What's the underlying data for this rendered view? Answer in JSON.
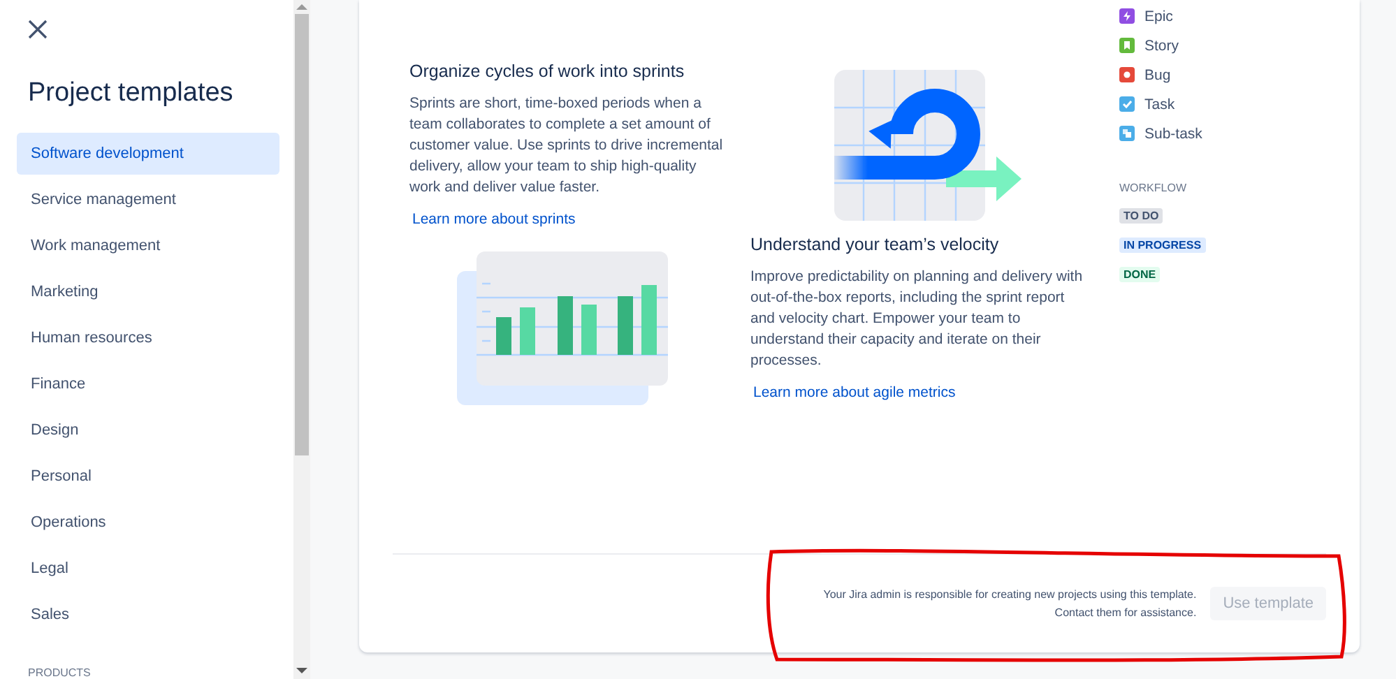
{
  "sidebar": {
    "title": "Project templates",
    "items": [
      {
        "label": "Software development",
        "selected": true
      },
      {
        "label": "Service management",
        "selected": false
      },
      {
        "label": "Work management",
        "selected": false
      },
      {
        "label": "Marketing",
        "selected": false
      },
      {
        "label": "Human resources",
        "selected": false
      },
      {
        "label": "Finance",
        "selected": false
      },
      {
        "label": "Design",
        "selected": false
      },
      {
        "label": "Personal",
        "selected": false
      },
      {
        "label": "Operations",
        "selected": false
      },
      {
        "label": "Legal",
        "selected": false
      },
      {
        "label": "Sales",
        "selected": false
      }
    ],
    "section_label": "PRODUCTS"
  },
  "features": [
    {
      "kind": "sprint",
      "title": "Organize cycles of work into sprints",
      "description": "Sprints are short, time-boxed periods when a team collaborates to complete a set amount of customer value. Use sprints to drive incremental delivery, allow your team to ship high-quality work and deliver value faster.",
      "link": "Learn more about sprints"
    },
    {
      "kind": "velocity",
      "title": "Understand your team’s velocity",
      "description": "Improve predictability on planning and delivery with out-of-the-box reports, including the sprint report and velocity chart. Empower your team to understand their capacity and iterate on their processes.",
      "link": "Learn more about agile metrics"
    }
  ],
  "issue_types": [
    {
      "label": "Epic",
      "kind": "epic"
    },
    {
      "label": "Story",
      "kind": "story"
    },
    {
      "label": "Bug",
      "kind": "bug"
    },
    {
      "label": "Task",
      "kind": "task"
    },
    {
      "label": "Sub-task",
      "kind": "subtask"
    }
  ],
  "workflow": {
    "label": "WORKFLOW",
    "statuses": [
      {
        "label": "TO DO",
        "kind": "todo"
      },
      {
        "label": "IN PROGRESS",
        "kind": "progress"
      },
      {
        "label": "DONE",
        "kind": "done"
      }
    ]
  },
  "footer": {
    "note_lines": [
      "Your Jira admin is responsible for creating new projects using this template.",
      "Contact them for assistance."
    ],
    "button": {
      "label": "Use template",
      "disabled": true
    }
  }
}
